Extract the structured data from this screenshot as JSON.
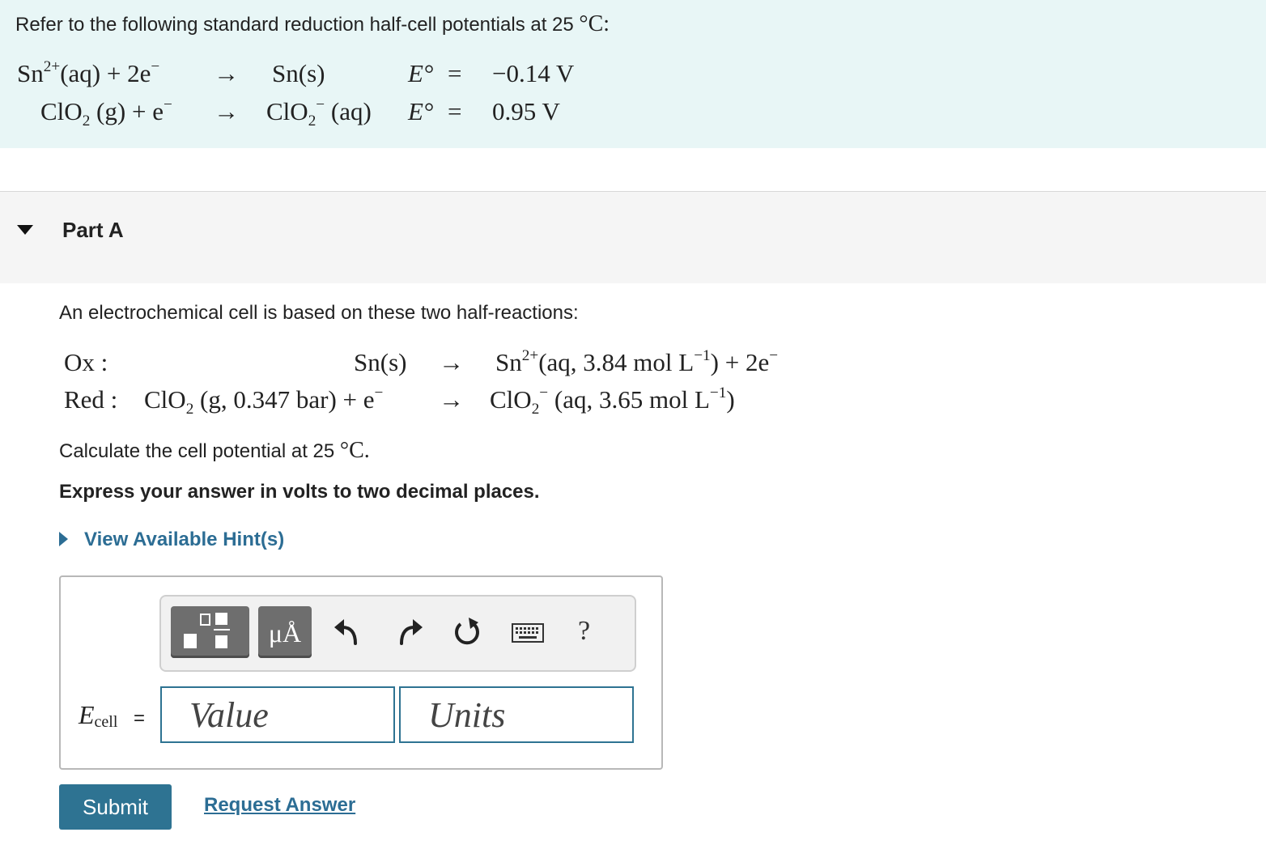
{
  "reference": {
    "intro_text": "Refer to the following standard reduction half-cell potentials at 25 ",
    "intro_unit": "°C",
    "intro_end": ":",
    "half_reactions": [
      {
        "reactant_species": "Sn",
        "reactant_charge": "2+",
        "reactant_state": "(aq)",
        "plus": "+",
        "electrons": "2e",
        "electron_charge": "−",
        "arrow": "→",
        "product": "Sn(s)",
        "e_label": "E°",
        "equals": "=",
        "potential": "−0.14 V"
      },
      {
        "reactant_species": "ClO",
        "reactant_sub": "2",
        "reactant_state": "(g)",
        "plus": "+",
        "electrons": "e",
        "electron_charge": "−",
        "arrow": "→",
        "product_species": "ClO",
        "product_sub": "2",
        "product_charge": "−",
        "product_state": "(aq)",
        "e_label": "E°",
        "equals": "=",
        "potential": "0.95 V"
      }
    ]
  },
  "part": {
    "title": "Part A"
  },
  "question": {
    "intro": "An electrochemical cell is based on these two half-reactions:",
    "ox_label": "Ox :",
    "ox_reactant": "Sn(s)",
    "ox_arrow": "→",
    "ox_product_species": "Sn",
    "ox_product_charge": "2+",
    "ox_product_state": "(aq,  3.84 mol L",
    "ox_product_exp": "−1",
    "ox_product_close": ")",
    "ox_plus": "+",
    "ox_electrons": "2e",
    "ox_electron_charge": "−",
    "red_label": "Red :",
    "red_reactant_species": "ClO",
    "red_reactant_sub": "2",
    "red_reactant_state": "(g,  0.347 bar)",
    "red_plus": "+",
    "red_electrons": "e",
    "red_electron_charge": "−",
    "red_arrow": "→",
    "red_product_species": "ClO",
    "red_product_sub": "2",
    "red_product_charge": "−",
    "red_product_state": "(aq,  3.65 mol L",
    "red_product_exp": "−1",
    "red_product_close": ")",
    "calc_text": "Calculate the cell potential at 25 ",
    "calc_unit": "°C",
    "calc_end": ".",
    "express_text": "Express your answer in volts to two decimal places."
  },
  "hint": {
    "label": "View Available Hint(s)"
  },
  "answer": {
    "toolbar": {
      "units_symbols_label": "μÅ",
      "help_label": "?"
    },
    "variable_symbol": "E",
    "variable_sub": "cell",
    "equals": "=",
    "value_placeholder": "Value",
    "units_placeholder": "Units"
  },
  "actions": {
    "submit_label": "Submit",
    "request_answer_label": "Request Answer"
  }
}
